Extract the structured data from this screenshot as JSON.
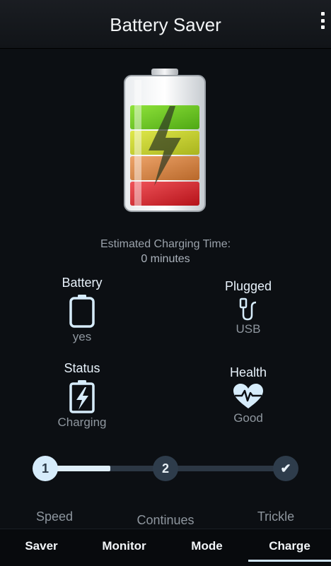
{
  "app": {
    "title": "Battery Saver"
  },
  "charging": {
    "estimate_label": "Estimated Charging Time:",
    "estimate_value": "0  minutes"
  },
  "stats": {
    "battery": {
      "label": "Battery",
      "value": "yes"
    },
    "plugged": {
      "label": "Plugged",
      "value": "USB"
    },
    "status": {
      "label": "Status",
      "value": "Charging"
    },
    "health": {
      "label": "Health",
      "value": "Good"
    }
  },
  "stepper": {
    "current_step": 1,
    "progress": 0.27,
    "steps": [
      {
        "marker": "1",
        "label": "Speed"
      },
      {
        "marker": "2",
        "label": "Continues"
      },
      {
        "marker": "✔",
        "label": "Trickle"
      }
    ]
  },
  "tabs": [
    {
      "label": "Saver",
      "active": false
    },
    {
      "label": "Monitor",
      "active": false
    },
    {
      "label": "Mode",
      "active": false
    },
    {
      "label": "Charge",
      "active": true
    }
  ],
  "icons": {
    "overflow": "overflow-menu-icon",
    "battery": "battery-outline-icon",
    "plugged": "usb-cable-icon",
    "status": "battery-charging-icon",
    "health": "heart-pulse-icon"
  },
  "colors": {
    "background": "#0c0f13",
    "accent": "#d6ecfb",
    "level_green": "#6fcf20",
    "level_yellow": "#c9d42a",
    "level_orange": "#d9873e",
    "level_red": "#d8232a"
  }
}
